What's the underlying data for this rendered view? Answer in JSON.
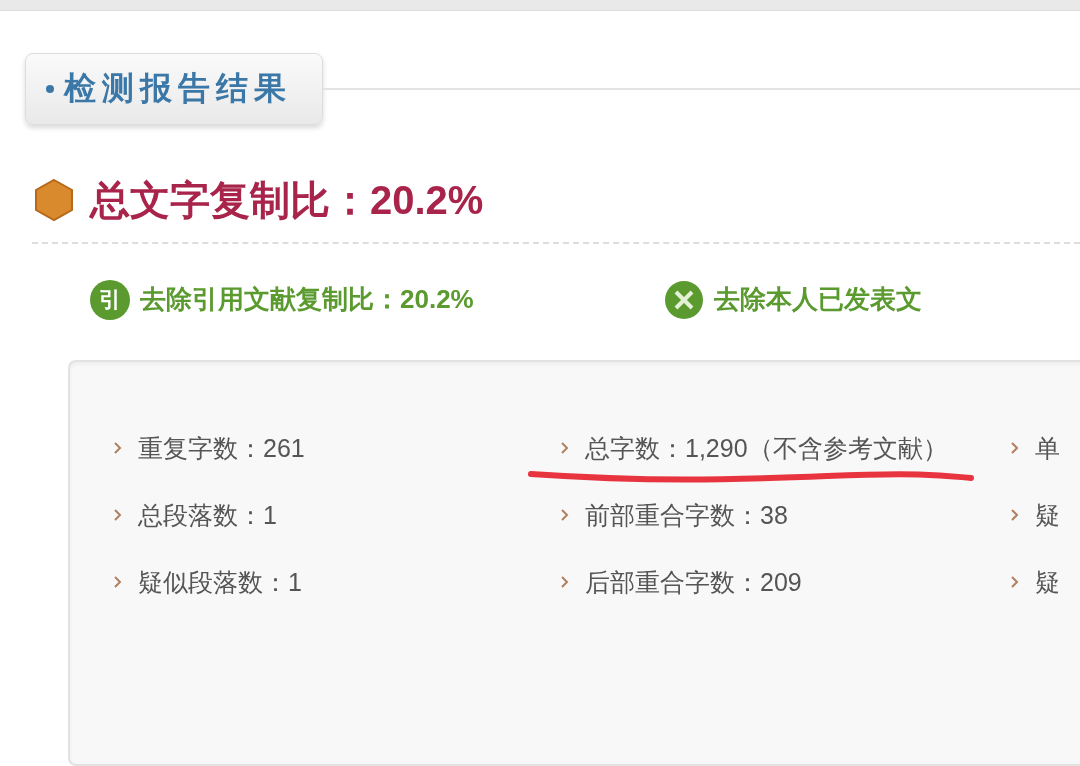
{
  "tab": {
    "label": "检测报告结果"
  },
  "total": {
    "label": "总文字复制比：20.2%"
  },
  "ratios": [
    {
      "badge": "引",
      "label": "去除引用文献复制比：20.2%"
    },
    {
      "label": "去除本人已发表文"
    }
  ],
  "stats": [
    {
      "cells": [
        {
          "text": "重复字数：261",
          "underlined": false
        },
        {
          "text": "总字数：1,290（不含参考文献）",
          "underlined": true
        },
        {
          "text": "单",
          "underlined": false
        }
      ]
    },
    {
      "cells": [
        {
          "text": "总段落数：1",
          "underlined": false
        },
        {
          "text": "前部重合字数：38",
          "underlined": false
        },
        {
          "text": "疑",
          "underlined": false
        }
      ]
    },
    {
      "cells": [
        {
          "text": "疑似段落数：1",
          "underlined": false
        },
        {
          "text": "后部重合字数：209",
          "underlined": false
        },
        {
          "text": "疑",
          "underlined": false
        }
      ]
    }
  ]
}
